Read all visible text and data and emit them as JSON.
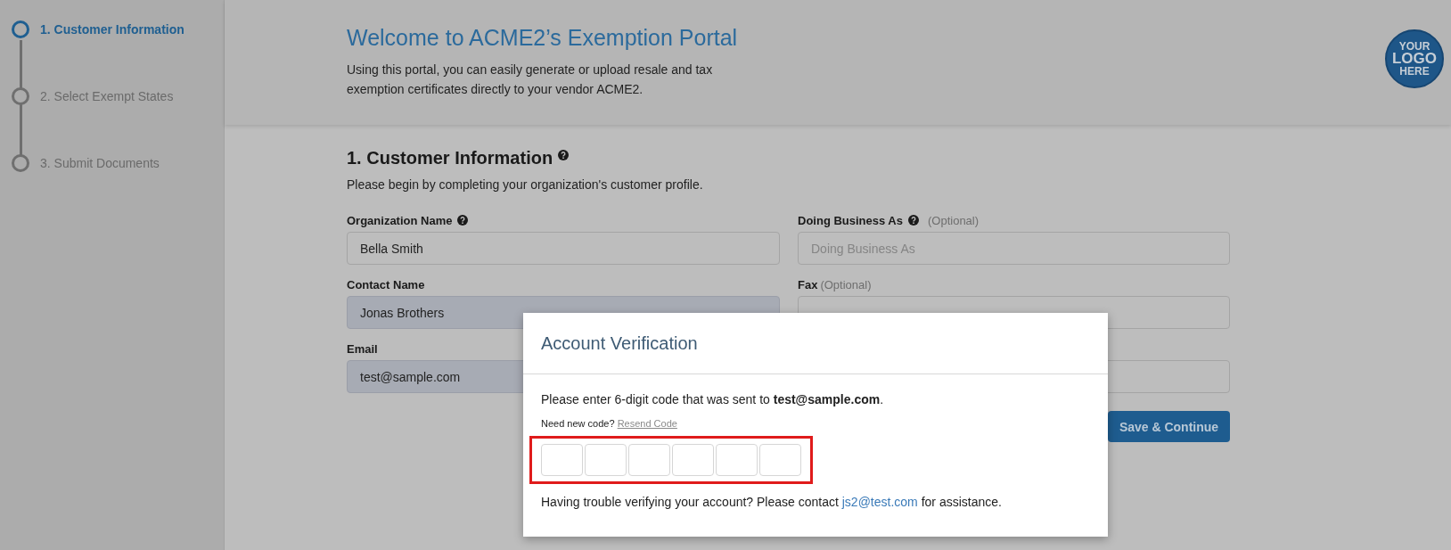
{
  "steps": [
    {
      "label": "1. Customer Information",
      "selected": true
    },
    {
      "label": "2. Select Exempt States",
      "selected": false
    },
    {
      "label": "3. Submit Documents",
      "selected": false
    }
  ],
  "header": {
    "title": "Welcome to ACME2’s Exemption Portal",
    "description": "Using this portal, you can easily generate or upload resale and tax exemption certificates directly to your vendor ACME2.",
    "logo": [
      "YOUR",
      "LOGO",
      "HERE"
    ]
  },
  "form": {
    "title": "1. Customer Information",
    "title_help": true,
    "subtitle": "Please begin by completing your organization's customer profile.",
    "fields": [
      {
        "label": "Organization Name",
        "help": true,
        "value": "Bella Smith",
        "autofilled": false
      },
      {
        "label": "Doing Business As",
        "help": true,
        "optional": "(Optional)",
        "placeholder": "Doing Business As",
        "autofilled": false
      },
      {
        "label": "Contact Name",
        "help": false,
        "value": "Jonas Brothers",
        "autofilled": true
      },
      {
        "label": "Fax",
        "help": false,
        "optional": "(Optional)",
        "autofilled": false
      },
      {
        "label": "Email",
        "help": false,
        "value": "test@sample.com",
        "autofilled": true
      },
      {
        "help": false,
        "autofilled": false
      }
    ],
    "save_button": "Save & Continue"
  },
  "modal": {
    "title": "Account Verification",
    "prompt": "Please enter 6-digit code that was sent to **test@sample.com**.",
    "resend_prompt": "Need new code?",
    "resend_link": "Resend Code",
    "code_cells": [
      {
        "filled": false
      },
      {
        "filled": false
      },
      {
        "filled": false
      },
      {
        "filled": false
      },
      {
        "filled": false
      },
      {
        "filled": false
      }
    ],
    "highlighted": true,
    "help_text": "Having trouble verifying your account? Please contact",
    "help_email": "js2@test.com",
    "help_suffix": "for assistance."
  }
}
